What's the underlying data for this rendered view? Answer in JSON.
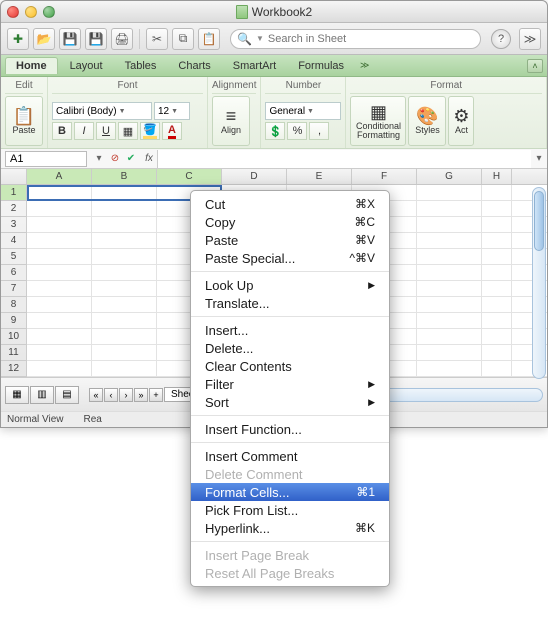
{
  "window": {
    "title": "Workbook2"
  },
  "search": {
    "placeholder": "Search in Sheet"
  },
  "ribbonTabs": {
    "home": "Home",
    "layout": "Layout",
    "tables": "Tables",
    "charts": "Charts",
    "smartart": "SmartArt",
    "formulas": "Formulas"
  },
  "ribbon": {
    "edit": {
      "label": "Edit",
      "paste": "Paste"
    },
    "font": {
      "label": "Font",
      "name": "Calibri (Body)",
      "size": "12",
      "bold": "B",
      "italic": "I",
      "underline": "U"
    },
    "alignment": {
      "label": "Alignment",
      "align": "Align"
    },
    "number": {
      "label": "Number",
      "format": "General"
    },
    "format": {
      "label": "Format",
      "cond": "Conditional Formatting",
      "styles": "Styles",
      "act": "Act"
    }
  },
  "nameBox": "A1",
  "fx": "fx",
  "columns": [
    "A",
    "B",
    "C",
    "D",
    "E",
    "F",
    "G",
    "H"
  ],
  "rows": [
    "1",
    "2",
    "3",
    "4",
    "5",
    "6",
    "7",
    "8",
    "9",
    "10",
    "11",
    "12"
  ],
  "status": {
    "view": "Normal View",
    "ready": "Rea"
  },
  "sheetTab": "Sheet",
  "contextMenu": {
    "cut": {
      "label": "Cut",
      "short": "⌘X"
    },
    "copy": {
      "label": "Copy",
      "short": "⌘C"
    },
    "paste": {
      "label": "Paste",
      "short": "⌘V"
    },
    "pasteSpecial": {
      "label": "Paste Special...",
      "short": "^⌘V"
    },
    "lookUp": {
      "label": "Look Up"
    },
    "translate": {
      "label": "Translate..."
    },
    "insert": {
      "label": "Insert..."
    },
    "delete": {
      "label": "Delete..."
    },
    "clear": {
      "label": "Clear Contents"
    },
    "filter": {
      "label": "Filter"
    },
    "sort": {
      "label": "Sort"
    },
    "insertFn": {
      "label": "Insert Function..."
    },
    "insertComment": {
      "label": "Insert Comment"
    },
    "deleteComment": {
      "label": "Delete Comment"
    },
    "formatCells": {
      "label": "Format Cells...",
      "short": "⌘1"
    },
    "pickList": {
      "label": "Pick From List..."
    },
    "hyperlink": {
      "label": "Hyperlink...",
      "short": "⌘K"
    },
    "insertPB": {
      "label": "Insert Page Break"
    },
    "resetPB": {
      "label": "Reset All Page Breaks"
    }
  }
}
